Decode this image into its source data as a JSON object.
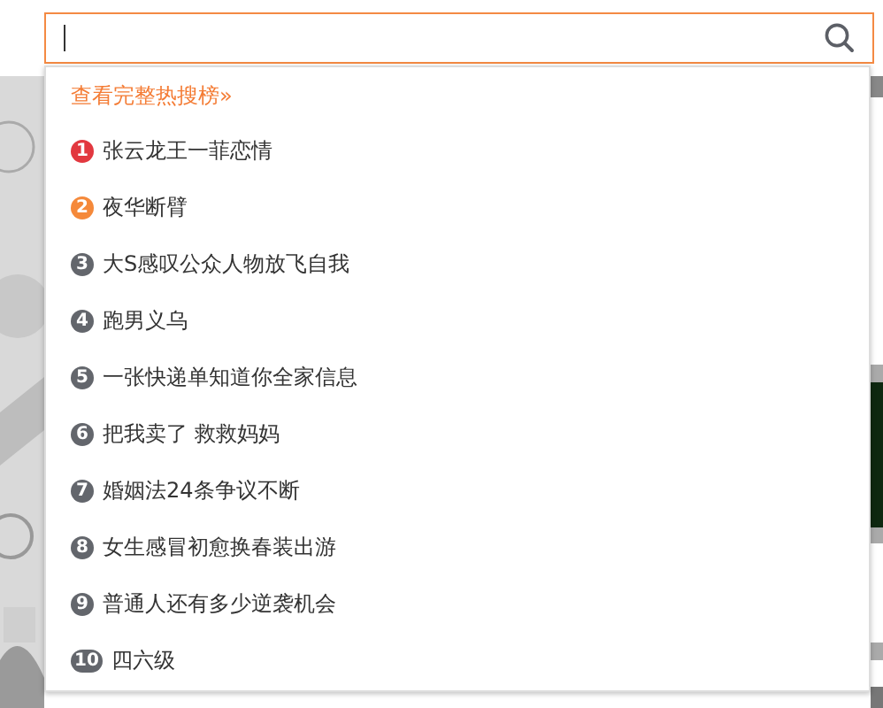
{
  "dropdown": {
    "link": "查看完整热搜榜»",
    "items": [
      {
        "rank": "1",
        "title": "张云龙王一菲恋情",
        "color": "#e2383f"
      },
      {
        "rank": "2",
        "title": "夜华断臂",
        "color": "#f5893a"
      },
      {
        "rank": "3",
        "title": "大S感叹公众人物放飞自我",
        "color": "#63666c"
      },
      {
        "rank": "4",
        "title": "跑男义乌",
        "color": "#63666c"
      },
      {
        "rank": "5",
        "title": "一张快递单知道你全家信息",
        "color": "#63666c"
      },
      {
        "rank": "6",
        "title": "把我卖了 救救妈妈",
        "color": "#63666c"
      },
      {
        "rank": "7",
        "title": "婚姻法24条争议不断",
        "color": "#63666c"
      },
      {
        "rank": "8",
        "title": "女生感冒初愈换春装出游",
        "color": "#63666c"
      },
      {
        "rank": "9",
        "title": "普通人还有多少逆袭机会",
        "color": "#63666c"
      },
      {
        "rank": "10",
        "title": "四六级",
        "color": "#63666c"
      }
    ]
  }
}
